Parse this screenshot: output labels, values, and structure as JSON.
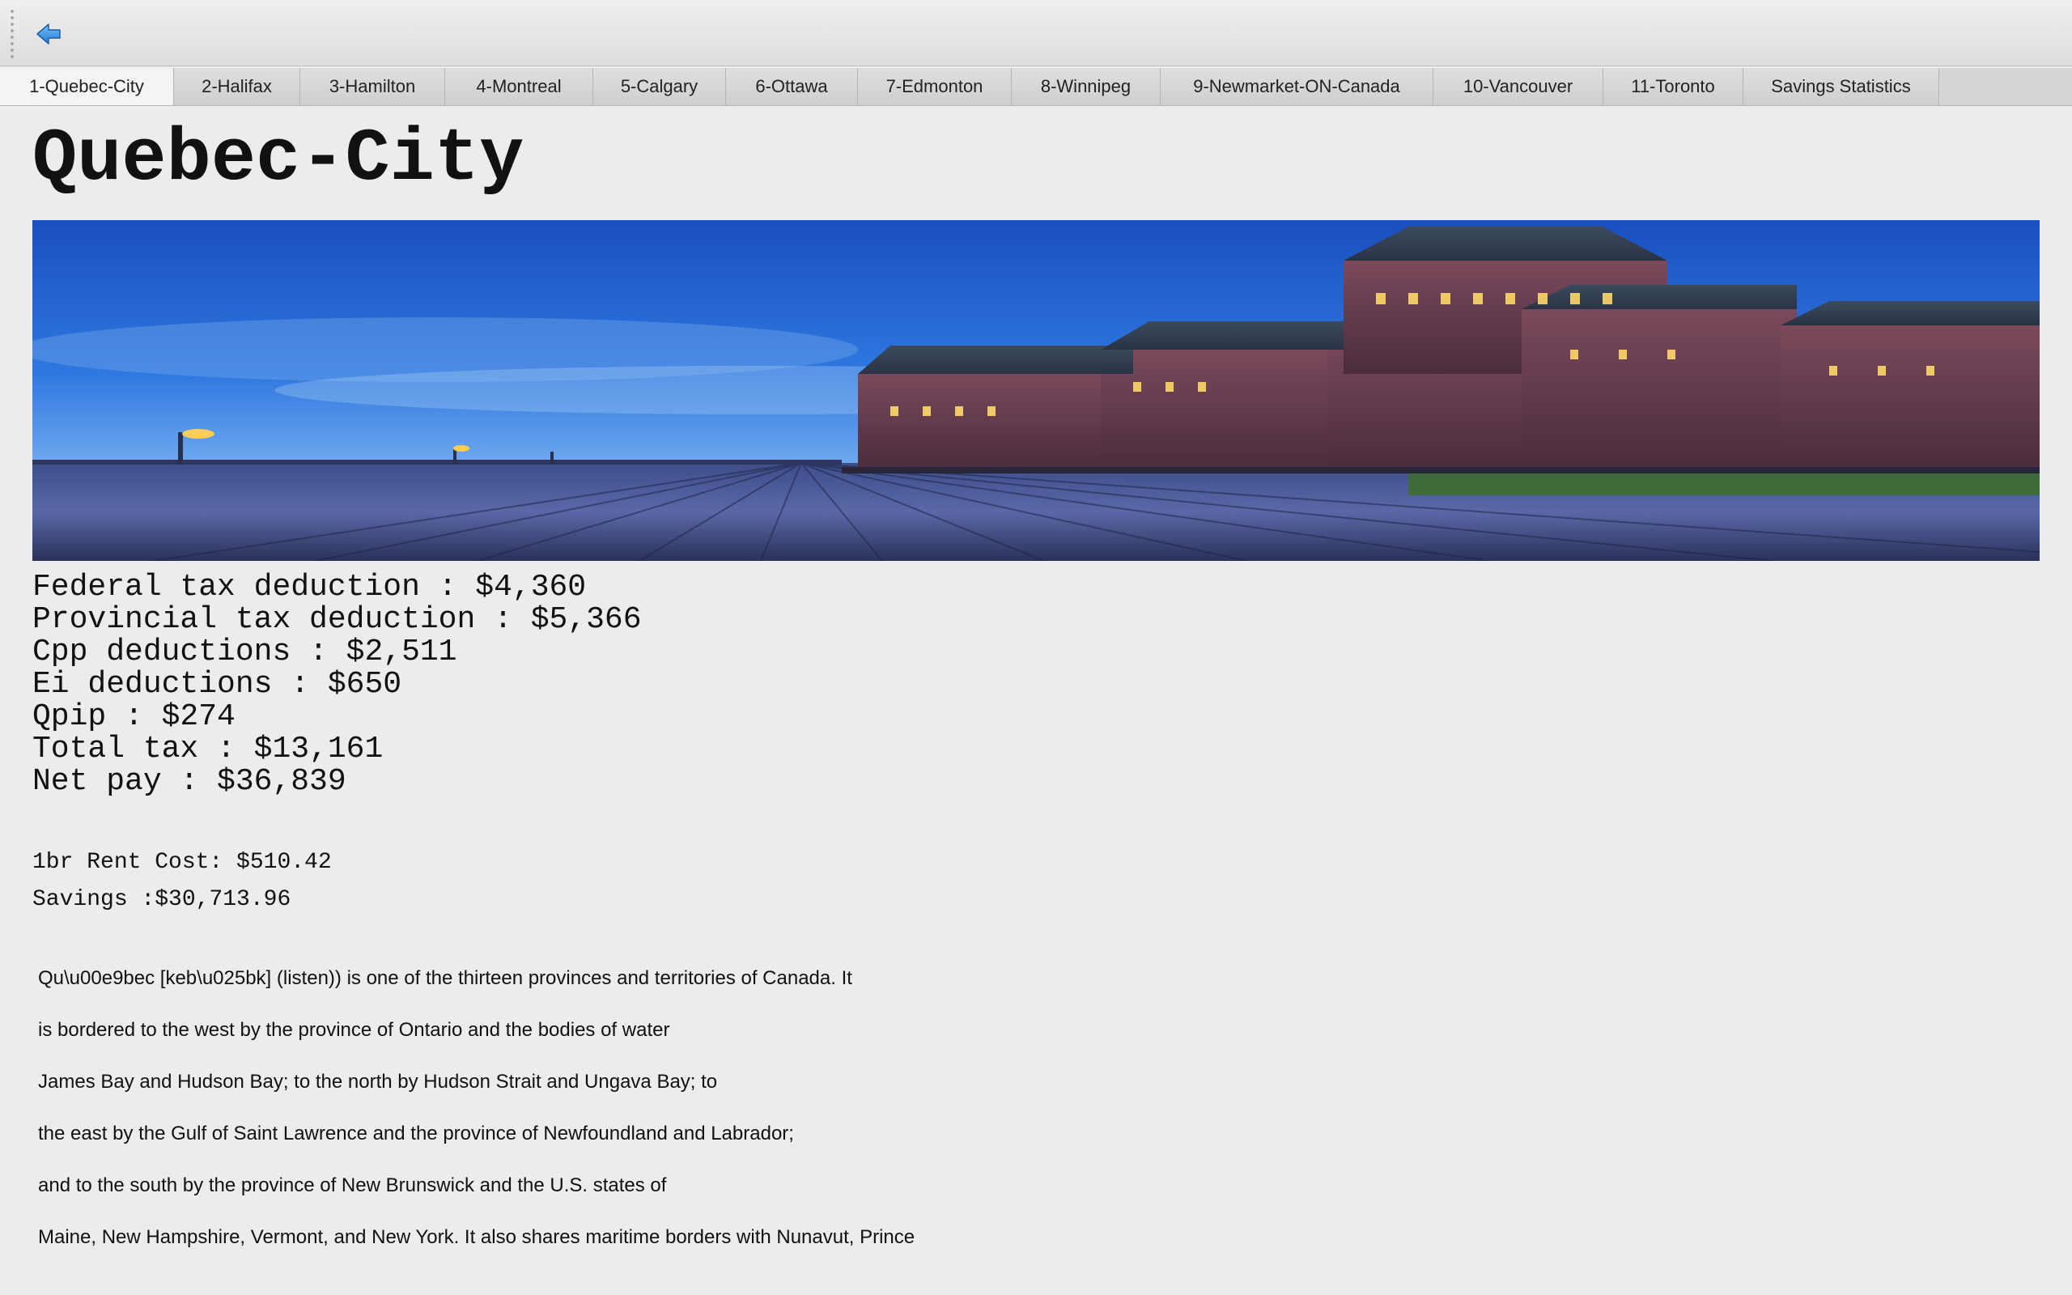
{
  "toolbar": {
    "back_icon": "back-arrow-icon",
    "accent": "#3a8fe0"
  },
  "tabs": [
    {
      "label": "1-Quebec-City",
      "active": true
    },
    {
      "label": "2-Halifax"
    },
    {
      "label": "3-Hamilton"
    },
    {
      "label": "4-Montreal"
    },
    {
      "label": "5-Calgary"
    },
    {
      "label": "6-Ottawa"
    },
    {
      "label": "7-Edmonton"
    },
    {
      "label": "8-Winnipeg"
    },
    {
      "label": "9-Newmarket-ON-Canada"
    },
    {
      "label": "10-Vancouver"
    },
    {
      "label": "11-Toronto"
    },
    {
      "label": "Savings Statistics"
    }
  ],
  "city": {
    "title": "Quebec-City",
    "tax_lines": [
      "Federal tax deduction : $4,360",
      "Provincial tax deduction : $5,366",
      "Cpp deductions : $2,511",
      "Ei deductions : $650",
      "Qpip : $274",
      "Total tax : $13,161",
      "Net pay : $36,839"
    ],
    "rent": "1br Rent Cost: $510.42",
    "savings": "Savings :$30,713.96",
    "description_lines": [
      "Qu\\u00e9bec [keb\\u025bk] (listen)) is one of the thirteen provinces and territories of Canada. It",
      "is bordered to the west by the province of Ontario and the bodies of water",
      "James Bay and Hudson Bay; to the north by Hudson Strait and Ungava Bay; to",
      "the east by the Gulf of Saint Lawrence and the province of Newfoundland and Labrador;",
      "and to the south by the province of New Brunswick and the U.S. states of",
      "Maine, New Hampshire, Vermont, and New York. It also shares maritime borders with Nunavut, Prince"
    ]
  }
}
